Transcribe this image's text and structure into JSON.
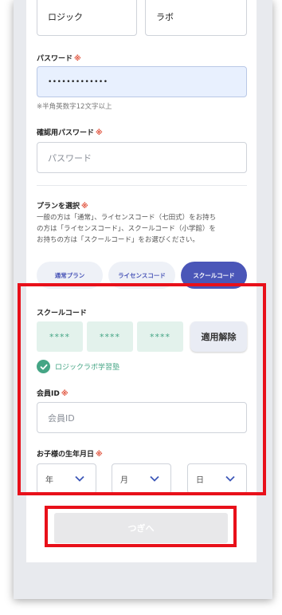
{
  "name_fields": {
    "last_name": "ロジック",
    "first_name": "ラボ"
  },
  "password": {
    "label": "パスワード",
    "required_mark": "※",
    "value": "•••••••••••••",
    "note": "※半角英数字12文字以上"
  },
  "password_confirm": {
    "label": "確認用パスワード",
    "required_mark": "※",
    "placeholder": "パスワード"
  },
  "plan": {
    "label": "プランを選択",
    "required_mark": "※",
    "help_lines": [
      "一般の方は「通常」、ライセンスコード（七田式）をお持ち",
      "の方は「ライセンスコード」、スクールコード（小学館）を",
      "お持ちの方は「スクールコード」をお選びください。"
    ],
    "options": [
      "通常プラン",
      "ライセンスコード",
      "スクールコード"
    ],
    "selected": "スクールコード"
  },
  "school_code": {
    "label": "スクールコード",
    "codes": [
      "****",
      "****",
      "****"
    ],
    "apply_label": "適用解除",
    "verified_text": "ロジックラボ学習塾"
  },
  "member_id": {
    "label": "会員ID",
    "required_mark": "※",
    "placeholder": "会員ID"
  },
  "birthday": {
    "label": "お子様の生年月日",
    "required_mark": "※",
    "year": "年",
    "month": "月",
    "day": "日"
  },
  "next_label": "つぎへ",
  "colors": {
    "accent": "#4a56b8",
    "success": "#45a585",
    "highlight": "#e8101a"
  }
}
